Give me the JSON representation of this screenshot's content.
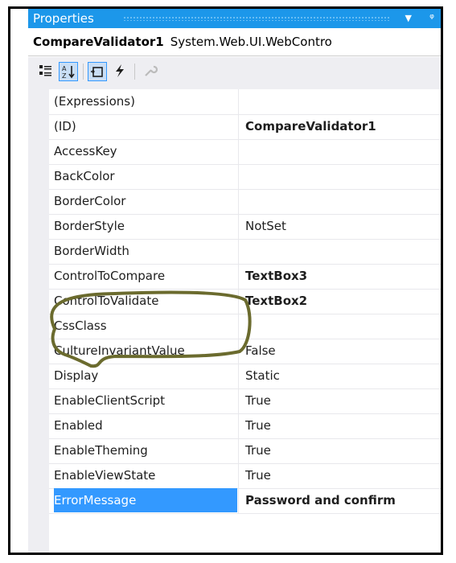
{
  "window": {
    "title": "Properties",
    "pin_glyph": "1̸"
  },
  "object_selector": {
    "name": "CompareValidator1",
    "type": "System.Web.UI.WebContro"
  },
  "toolbar": {
    "buttons": [
      {
        "icon": "categorized-icon",
        "active": false
      },
      {
        "icon": "alphabetical-sort-icon",
        "active": true
      },
      {
        "icon": "properties-icon",
        "active": true
      },
      {
        "icon": "events-lightning-icon",
        "active": false
      },
      {
        "icon": "property-pages-wrench-icon",
        "active": false,
        "disabled": true
      }
    ]
  },
  "properties": [
    {
      "name": "(Expressions)",
      "value": "",
      "bold": false
    },
    {
      "name": "(ID)",
      "value": "CompareValidator1",
      "bold": true
    },
    {
      "name": "AccessKey",
      "value": "",
      "bold": false
    },
    {
      "name": "BackColor",
      "value": "",
      "bold": false
    },
    {
      "name": "BorderColor",
      "value": "",
      "bold": false
    },
    {
      "name": "BorderStyle",
      "value": "NotSet",
      "bold": false
    },
    {
      "name": "BorderWidth",
      "value": "",
      "bold": false
    },
    {
      "name": "ControlToCompare",
      "value": "TextBox3",
      "bold": true
    },
    {
      "name": "ControlToValidate",
      "value": "TextBox2",
      "bold": true
    },
    {
      "name": "CssClass",
      "value": "",
      "bold": false
    },
    {
      "name": "CultureInvariantValue",
      "value": "False",
      "bold": false
    },
    {
      "name": "Display",
      "value": "Static",
      "bold": false
    },
    {
      "name": "EnableClientScript",
      "value": "True",
      "bold": false
    },
    {
      "name": "Enabled",
      "value": "True",
      "bold": false
    },
    {
      "name": "EnableTheming",
      "value": "True",
      "bold": false
    },
    {
      "name": "EnableViewState",
      "value": "True",
      "bold": false
    },
    {
      "name": "ErrorMessage",
      "value": "Password and confirm",
      "bold": true,
      "selected": true
    }
  ],
  "colors": {
    "title_bar": "#1c97ea",
    "selection": "#3399ff",
    "annotation": "#6b6b2e"
  }
}
